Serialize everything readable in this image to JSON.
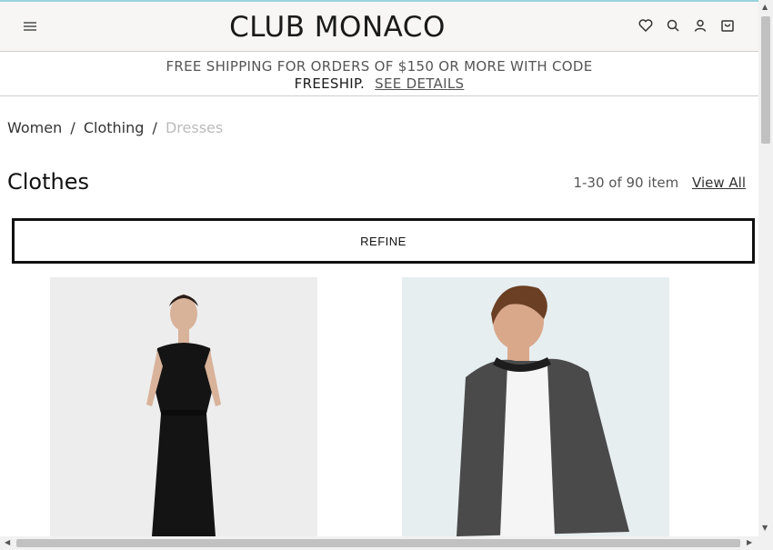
{
  "header": {
    "brand": "CLUB MONACO",
    "icons": [
      "menu-icon",
      "heart-icon",
      "search-icon",
      "account-icon",
      "cart-icon"
    ]
  },
  "promo": {
    "line1": "FREE SHIPPING FOR ORDERS OF $150 OR MORE WITH CODE",
    "code": "FREESHIP.",
    "link": "SEE DETAILS"
  },
  "breadcrumb": {
    "items": [
      "Women",
      "Clothing",
      "Dresses"
    ],
    "separator": "/"
  },
  "listing": {
    "title": "Clothes",
    "count": "1-30 of 90 item",
    "view_all": "View All",
    "refine": "REFINE"
  },
  "colors": {
    "accent_line": "#9ad3dd",
    "header_bg": "#f7f6f4"
  }
}
